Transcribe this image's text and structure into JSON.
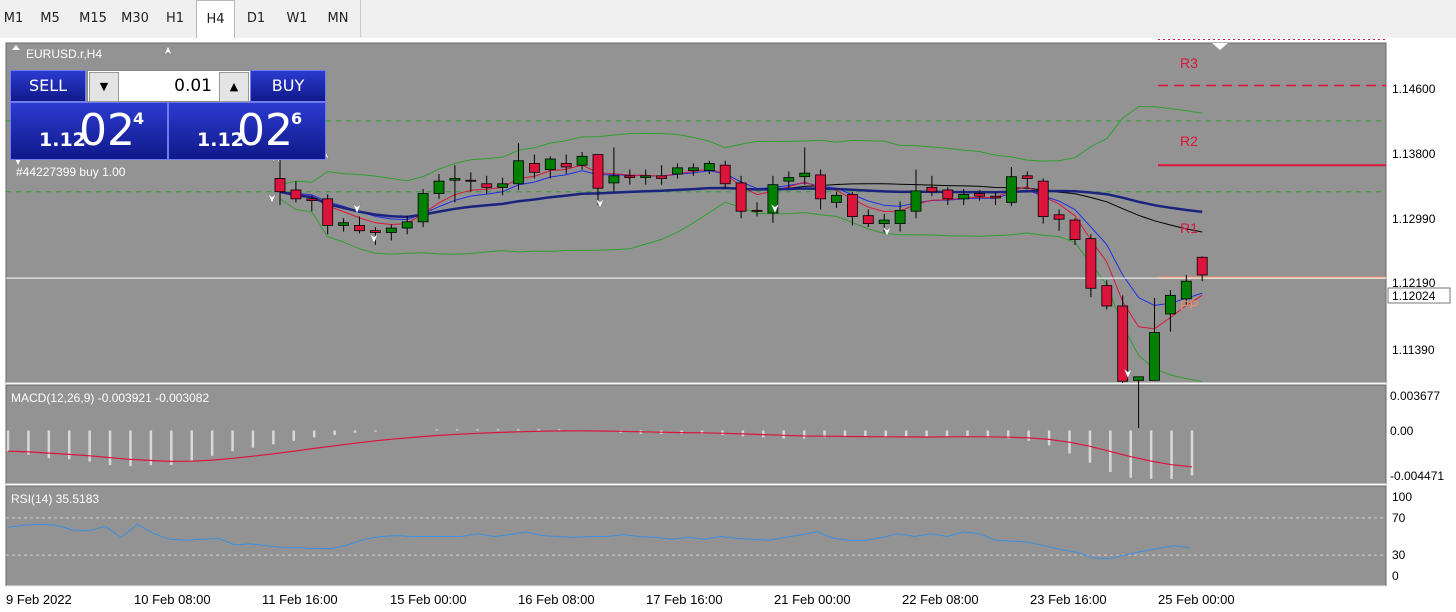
{
  "timeframes": [
    "M1",
    "M5",
    "M15",
    "M30",
    "H1",
    "H4",
    "D1",
    "W1",
    "MN"
  ],
  "active_timeframe": "H4",
  "symbol_label": "EURUSD.r,H4",
  "trade_panel": {
    "sell_label": "SELL",
    "buy_label": "BUY",
    "lot": "0.01",
    "sell_price": {
      "big_figure": "1.12",
      "pips": "02",
      "fraction": "4"
    },
    "buy_price": {
      "big_figure": "1.12",
      "pips": "02",
      "fraction": "6"
    }
  },
  "order_label": "#44227399 buy 1.00",
  "pivot_labels": {
    "r3": "R3",
    "r2": "R2",
    "r1": "R1",
    "pp": "PP"
  },
  "current_price": "1.12024",
  "price_axis": [
    "1.14600",
    "1.13800",
    "1.12990",
    "1.12190",
    "1.11390"
  ],
  "macd": {
    "label": "MACD(12,26,9) -0.003921 -0.003082",
    "axis": [
      "0.003677",
      "0.00",
      "-0.004471"
    ]
  },
  "rsi": {
    "label": "RSI(14) 35.5183",
    "axis": [
      "100",
      "70",
      "30",
      "0"
    ]
  },
  "time_axis": [
    "9 Feb 2022",
    "10 Feb 08:00",
    "11 Feb 16:00",
    "15 Feb 00:00",
    "16 Feb 08:00",
    "17 Feb 16:00",
    "21 Feb 00:00",
    "22 Feb 08:00",
    "23 Feb 16:00",
    "25 Feb 00:00"
  ],
  "colors": {
    "background": "#939393",
    "bull": "#008000",
    "bear": "#dc143c",
    "pivot": "#dc143c",
    "pp": "#f08c64",
    "rsi": "#3a8fe0",
    "macd_signal": "#dc143c"
  },
  "chart_data": {
    "type": "candlestick",
    "candles": [
      [
        1.1315,
        1.1348,
        1.1285,
        1.13
      ],
      [
        1.1302,
        1.1312,
        1.1288,
        1.1292
      ],
      [
        1.1292,
        1.1296,
        1.1278,
        1.129
      ],
      [
        1.1292,
        1.1297,
        1.1252,
        1.1262
      ],
      [
        1.1262,
        1.127,
        1.1255,
        1.1265
      ],
      [
        1.1262,
        1.1272,
        1.1253,
        1.1256
      ],
      [
        1.1256,
        1.126,
        1.124,
        1.1254
      ],
      [
        1.1254,
        1.1263,
        1.1245,
        1.1259
      ],
      [
        1.1259,
        1.1273,
        1.1252,
        1.1266
      ],
      [
        1.1266,
        1.1303,
        1.126,
        1.1298
      ],
      [
        1.1298,
        1.132,
        1.1292,
        1.1312
      ],
      [
        1.1313,
        1.133,
        1.1288,
        1.1315
      ],
      [
        1.1313,
        1.1322,
        1.13,
        1.1312
      ],
      [
        1.1309,
        1.1318,
        1.1298,
        1.1305
      ],
      [
        1.1305,
        1.1316,
        1.1296,
        1.1309
      ],
      [
        1.1309,
        1.1355,
        1.1302,
        1.1335
      ],
      [
        1.1332,
        1.1342,
        1.1315,
        1.1322
      ],
      [
        1.1325,
        1.134,
        1.1315,
        1.1337
      ],
      [
        1.1332,
        1.1342,
        1.132,
        1.1328
      ],
      [
        1.133,
        1.1345,
        1.1325,
        1.134
      ],
      [
        1.1342,
        1.134,
        1.1285,
        1.1304
      ],
      [
        1.131,
        1.135,
        1.13,
        1.1318
      ],
      [
        1.1318,
        1.1325,
        1.1308,
        1.1316
      ],
      [
        1.1316,
        1.1325,
        1.1308,
        1.1318
      ],
      [
        1.1318,
        1.133,
        1.1308,
        1.1315
      ],
      [
        1.132,
        1.1332,
        1.1315,
        1.1327
      ],
      [
        1.1324,
        1.1332,
        1.1318,
        1.1327
      ],
      [
        1.1324,
        1.1335,
        1.132,
        1.1332
      ],
      [
        1.133,
        1.1335,
        1.1303,
        1.1309
      ],
      [
        1.131,
        1.1318,
        1.127,
        1.1278
      ],
      [
        1.1279,
        1.1288,
        1.1272,
        1.1278
      ],
      [
        1.1276,
        1.1318,
        1.1265,
        1.1308
      ],
      [
        1.1312,
        1.1323,
        1.1304,
        1.1316
      ],
      [
        1.1317,
        1.135,
        1.1308,
        1.1321
      ],
      [
        1.1319,
        1.1325,
        1.128,
        1.1292
      ],
      [
        1.1288,
        1.13,
        1.1282,
        1.1296
      ],
      [
        1.1297,
        1.13,
        1.1262,
        1.1272
      ],
      [
        1.1273,
        1.128,
        1.126,
        1.1264
      ],
      [
        1.1264,
        1.1275,
        1.1254,
        1.1268
      ],
      [
        1.1264,
        1.1289,
        1.1255,
        1.1279
      ],
      [
        1.1278,
        1.1325,
        1.127,
        1.1301
      ],
      [
        1.1305,
        1.1318,
        1.1295,
        1.13
      ],
      [
        1.1302,
        1.1305,
        1.1285,
        1.1292
      ],
      [
        1.1292,
        1.1303,
        1.1285,
        1.1297
      ],
      [
        1.1298,
        1.1302,
        1.129,
        1.1295
      ],
      [
        1.1295,
        1.13,
        1.1285,
        1.1293
      ],
      [
        1.1288,
        1.1328,
        1.1284,
        1.1317
      ],
      [
        1.1318,
        1.1323,
        1.1305,
        1.1315
      ],
      [
        1.1312,
        1.1315,
        1.1264,
        1.1272
      ],
      [
        1.1274,
        1.128,
        1.1256,
        1.1269
      ],
      [
        1.1268,
        1.127,
        1.124,
        1.1246
      ],
      [
        1.1247,
        1.1252,
        1.1181,
        1.1191
      ],
      [
        1.1194,
        1.12,
        1.1167,
        1.1171
      ],
      [
        1.1171,
        1.1183,
        1.1084,
        1.1086
      ],
      [
        1.1087,
        1.1091,
        1.1033,
        1.1091
      ],
      [
        1.1087,
        1.118,
        1.1093,
        1.1141
      ],
      [
        1.1162,
        1.1189,
        1.1142,
        1.1183
      ],
      [
        1.1179,
        1.1206,
        1.1172,
        1.1199
      ],
      [
        1.1226,
        1.1227,
        1.1199,
        1.1206
      ]
    ],
    "y_range": [
      1.1084,
      1.1468
    ],
    "pivots": {
      "R3": 1.1472,
      "R2": 1.142,
      "R1": 1.133,
      "PP": 1.1203
    },
    "current_price": 1.12024,
    "macd_range": [
      -0.004471,
      0.003677
    ],
    "macd_hist": [
      -0.0018,
      -0.0021,
      -0.0024,
      -0.0025,
      -0.0027,
      -0.003,
      -0.0031,
      -0.003,
      -0.003,
      -0.0026,
      -0.0022,
      -0.0018,
      -0.0015,
      -0.0012,
      -0.0009,
      -0.0006,
      -0.0004,
      -0.0002,
      -0.0001,
      0.0,
      0.0,
      0.0001,
      0.0001,
      0.0001,
      0.0001,
      0.0001,
      0.0001,
      0.0001,
      0.0,
      -0.0001,
      -0.0002,
      -0.0003,
      -0.0003,
      -0.0003,
      -0.0003,
      -0.0004,
      -0.0005,
      -0.0006,
      -0.0007,
      -0.0007,
      -0.0006,
      -0.0006,
      -0.0006,
      -0.0006,
      -0.0006,
      -0.0006,
      -0.0005,
      -0.0005,
      -0.0006,
      -0.0007,
      -0.0009,
      -0.0013,
      -0.002,
      -0.0028,
      -0.0036,
      -0.0041,
      -0.0042,
      -0.0042,
      -0.0039
    ],
    "rsi_values": [
      60,
      62,
      63,
      62,
      57,
      56,
      61,
      49,
      63,
      53,
      47,
      46,
      47,
      48,
      41,
      42,
      40,
      38,
      38,
      37,
      37,
      41,
      47,
      50,
      51,
      50,
      50,
      50,
      50,
      53,
      50,
      52,
      55,
      51,
      50,
      49,
      50,
      50,
      52,
      50,
      49,
      47,
      49,
      47,
      50,
      48,
      47,
      46,
      49,
      52,
      55,
      48,
      46,
      46,
      49,
      53,
      50,
      53,
      50,
      55,
      53,
      46,
      45,
      44,
      40,
      36,
      33,
      27,
      26,
      30,
      34,
      37,
      40,
      38
    ]
  }
}
